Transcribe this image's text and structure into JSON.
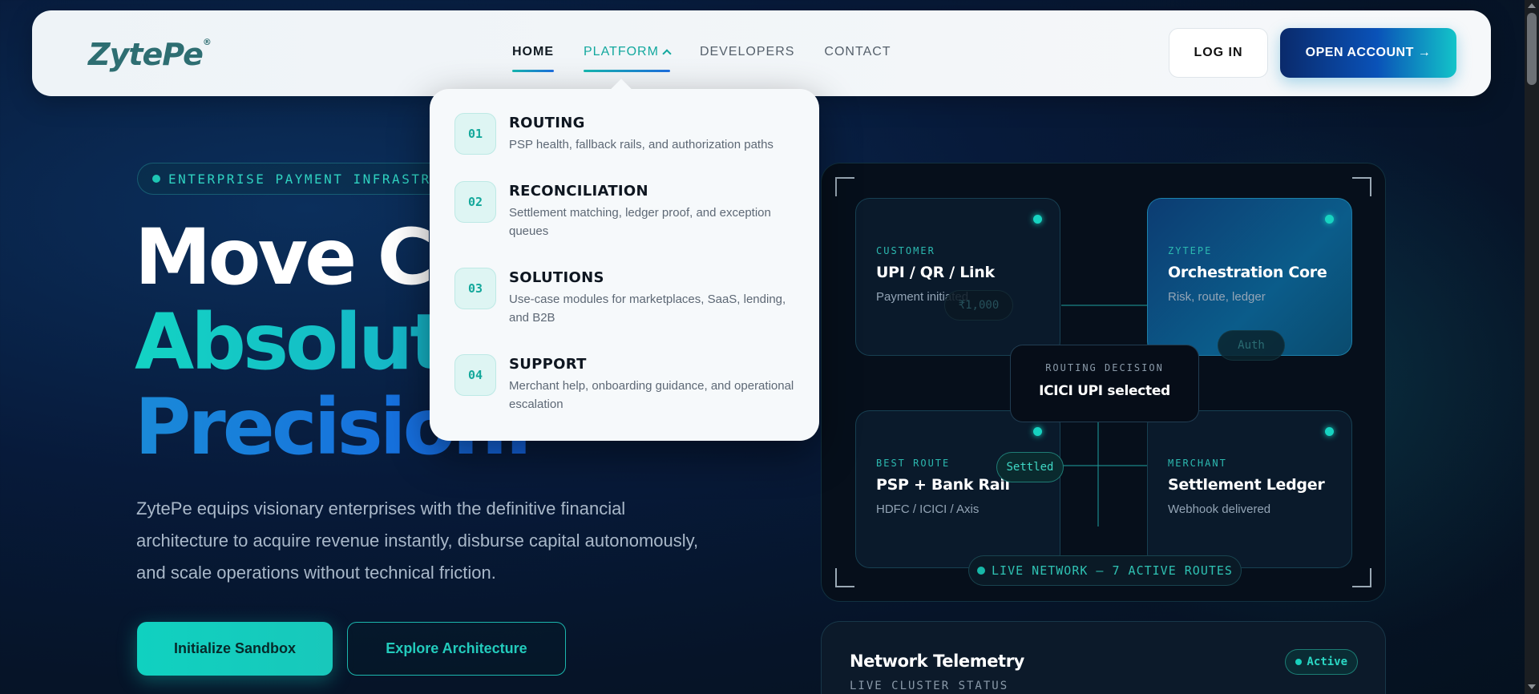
{
  "brand": {
    "logo_text": "ZytePe",
    "registered": "®"
  },
  "nav": {
    "links": [
      {
        "label": "HOME"
      },
      {
        "label": "PLATFORM"
      },
      {
        "label": "DEVELOPERS"
      },
      {
        "label": "CONTACT"
      }
    ],
    "login_label": "LOG IN",
    "open_account_label": "OPEN ACCOUNT →"
  },
  "platform_menu": {
    "items": [
      {
        "num": "01",
        "title": "ROUTING",
        "desc": "PSP health, fallback rails, and authorization paths"
      },
      {
        "num": "02",
        "title": "RECONCILIATION",
        "desc": "Settlement matching, ledger proof, and exception queues"
      },
      {
        "num": "03",
        "title": "SOLUTIONS",
        "desc": "Use-case modules for marketplaces, SaaS, lending, and B2B"
      },
      {
        "num": "04",
        "title": "SUPPORT",
        "desc": "Merchant help, onboarding guidance, and operational escalation"
      }
    ]
  },
  "hero": {
    "badge": "ENTERPRISE PAYMENT INFRASTRUCTU",
    "headline_line1": "Move Ca",
    "headline_line2": "Absolute",
    "headline_line3": "Precision.",
    "lede": "ZytePe equips visionary enterprises with the definitive financial architecture to acquire revenue instantly, disburse capital autonomously, and scale operations without technical friction.",
    "primary_cta": "Initialize Sandbox",
    "secondary_cta": "Explore Architecture"
  },
  "routing_panel": {
    "nodes": {
      "customer": {
        "tag": "CUSTOMER",
        "title": "UPI / QR / Link",
        "sub": "Payment initiated"
      },
      "core": {
        "tag": "ZYTEPE",
        "title": "Orchestration Core",
        "sub": "Risk, route, ledger"
      },
      "route": {
        "tag": "BEST ROUTE",
        "title": "PSP + Bank Rail",
        "sub": "HDFC / ICICI / Axis"
      },
      "merchant": {
        "tag": "MERCHANT",
        "title": "Settlement Ledger",
        "sub": "Webhook delivered"
      }
    },
    "chips": {
      "amount": "₹1,000",
      "auth": "Auth",
      "settled": "Settled"
    },
    "decision": {
      "tag": "ROUTING DECISION",
      "value": "ICICI UPI selected"
    },
    "live": "LIVE NETWORK — 7 ACTIVE ROUTES"
  },
  "telemetry": {
    "title": "Network Telemetry",
    "subtitle": "LIVE CLUSTER STATUS",
    "status": "Active"
  },
  "colors": {
    "accent": "#13d3c4",
    "brand_blue": "#1463e0",
    "nav_bg": "#f6f8fa"
  }
}
